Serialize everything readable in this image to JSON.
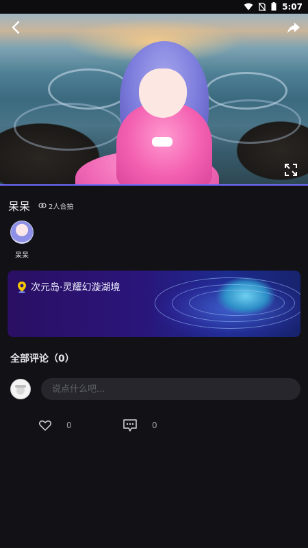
{
  "status_bar": {
    "time": "5:07",
    "icons": [
      "wifi-icon",
      "no-sim-icon",
      "battery-icon"
    ]
  },
  "hero": {
    "back_icon": "chevron-left-icon",
    "share_icon": "share-arrow-icon",
    "fullscreen_icon": "fullscreen-icon",
    "progress": 1.0
  },
  "post": {
    "title": "呆呆",
    "coshot_label": "2人合拍",
    "coshot_icon": "link-icon"
  },
  "participants": [
    {
      "name": "呆呆"
    }
  ],
  "location": {
    "icon": "location-pin-icon",
    "name": "次元岛·灵耀幻漩湖境"
  },
  "comments": {
    "title": "全部评论（0）",
    "input_placeholder": "说点什么吧..."
  },
  "actions": {
    "like_icon": "heart-icon",
    "like_count": "0",
    "comment_icon": "comment-icon",
    "comment_count": "0"
  },
  "colors": {
    "background": "#111116",
    "accent": "#6f6cff",
    "input_bg": "#26262c"
  }
}
